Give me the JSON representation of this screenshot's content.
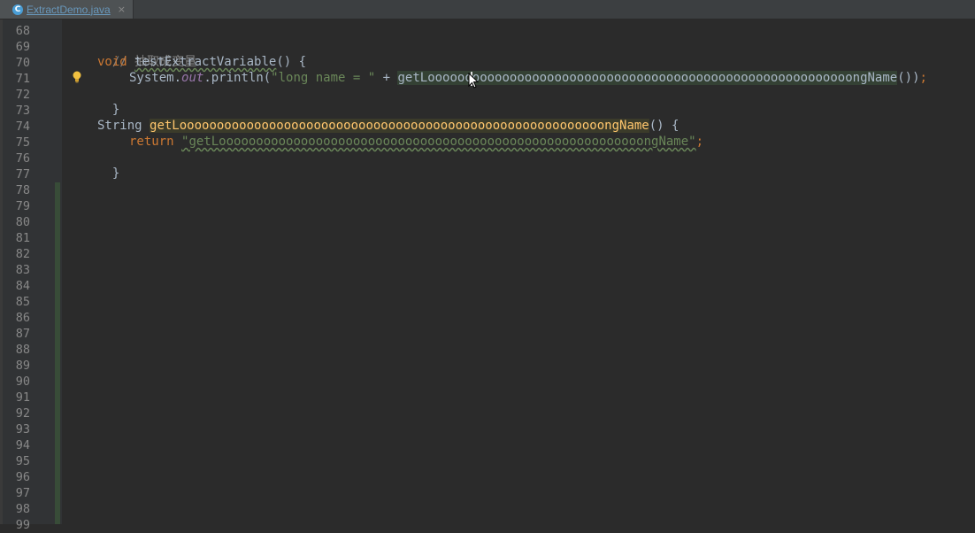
{
  "tab": {
    "icon_letter": "C",
    "filename": "ExtractDemo.java",
    "close": "×"
  },
  "gutter": {
    "line_numbers": [
      "68",
      "69",
      "70",
      "71",
      "72",
      "73",
      "74",
      "75",
      "76",
      "77",
      "78",
      "79",
      "80",
      "81",
      "82",
      "83",
      "84",
      "85",
      "86",
      "87",
      "88",
      "89",
      "90",
      "91",
      "92",
      "93",
      "94",
      "95",
      "96",
      "97",
      "98",
      "99"
    ]
  },
  "code": {
    "l69": "// 抽取成变量",
    "l70_kw": "void",
    "l70_name": "testExtractVariable",
    "l70_rest": "() {",
    "l71_a": "System.",
    "l71_field": "out",
    "l71_b": ".println(",
    "l71_str": "\"long name = \"",
    "l71_c": " + ",
    "l71_call": "getLooooooooooooooooooooooooooooooooooooooooooooooooooooooooongName",
    "l71_d": "())",
    "l71_semi": ";",
    "l72": "}",
    "l74_type": "String",
    "l74_name": "getLooooooooooooooooooooooooooooooooooooooooooooooooooooooooongName",
    "l74_rest": "() {",
    "l75_kw": "return",
    "l75_str": "\"getLooooooooooooooooooooooooooooooooooooooooooooooooooooooooongName\"",
    "l75_semi": ";",
    "l76": "}"
  },
  "colors": {
    "background": "#2b2b2b",
    "keyword": "#cc7832",
    "string": "#6a8759",
    "comment": "#808080",
    "method_declaration": "#ffc66d"
  }
}
